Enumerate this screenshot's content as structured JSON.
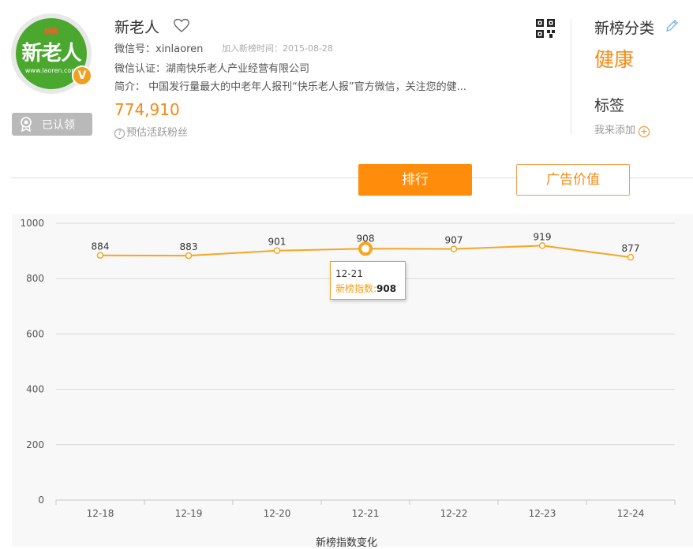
{
  "account": {
    "avatar_top": "枫网",
    "avatar_text": "新老人",
    "avatar_url": "www.laoren.com",
    "verified_mark": "V",
    "certified_label": "已认领",
    "name": "新老人",
    "wechat_id_label": "微信号：xinlaoren",
    "join_time": "加入新榜时间：2015-08-28",
    "certification": "微信认证：湖南快乐老人产业经营有限公司",
    "intro": "简介：  中国发行量最大的中老年人报刊“快乐老人报”官方微信，关注您的健...",
    "fans_count": "774,910",
    "fans_label": "预估活跃粉丝"
  },
  "side": {
    "category_title": "新榜分类",
    "category_value": "健康",
    "tag_title": "标签",
    "tag_add": "我来添加"
  },
  "tabs": {
    "rank": "排行",
    "ad_value": "广告价值"
  },
  "tooltip": {
    "date": "12-21",
    "label": "新榜指数:",
    "value": "908"
  },
  "colors": {
    "accent": "#ff8c0a",
    "line": "#f5a623",
    "grid": "#d8d8d8"
  },
  "chart_data": {
    "type": "line",
    "categories": [
      "12-18",
      "12-19",
      "12-20",
      "12-21",
      "12-22",
      "12-23",
      "12-24"
    ],
    "series": [
      {
        "name": "新榜指数",
        "values": [
          884,
          883,
          901,
          908,
          907,
          919,
          877
        ]
      }
    ],
    "ylim": [
      0,
      1000
    ],
    "yticks": [
      0,
      200,
      400,
      600,
      800,
      1000
    ],
    "xlabel": "新榜指数变化",
    "highlight_index": 3,
    "grid": true,
    "legend": "none"
  }
}
